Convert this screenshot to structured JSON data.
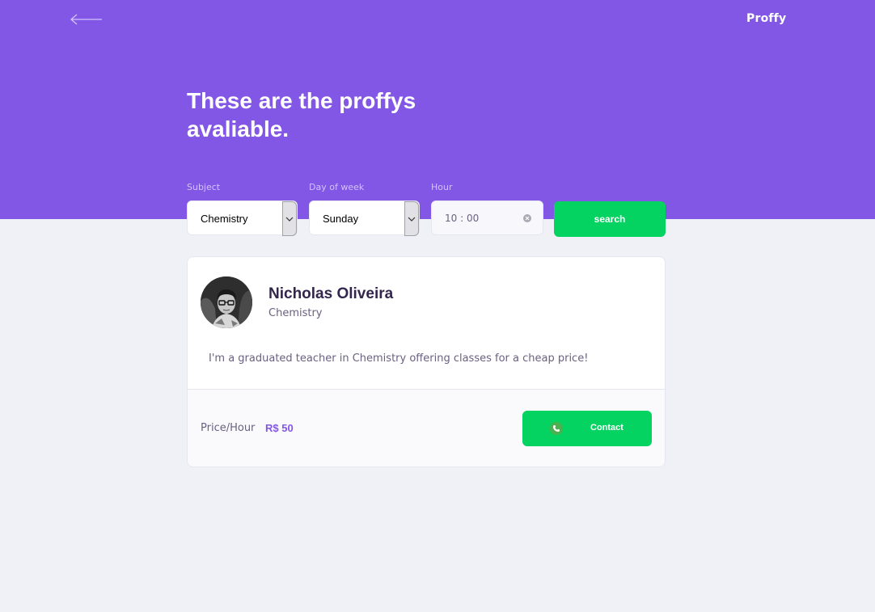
{
  "header": {
    "brand": "Proffy",
    "back_icon": "arrow-left-icon",
    "title": "These are the proffys avaliable."
  },
  "filters": {
    "subject": {
      "label": "Subject",
      "value": "Chemistry"
    },
    "day": {
      "label": "Day of week",
      "value": "Sunday"
    },
    "hour": {
      "label": "Hour",
      "value": "10 : 00"
    },
    "search_label": "search"
  },
  "teacher": {
    "name": "Nicholas Oliveira",
    "subject": "Chemistry",
    "bio": "I'm a graduated teacher in Chemistry offering classes for a cheap price!",
    "price_label": "Price/Hour",
    "price": "R$ 50",
    "contact_label": "Contact",
    "contact_icon": "phone-icon"
  },
  "colors": {
    "primary": "#8257E5",
    "background": "#F0F0F7",
    "green": "#04D361",
    "title_text": "#32264D",
    "body_text": "#6A6180"
  }
}
